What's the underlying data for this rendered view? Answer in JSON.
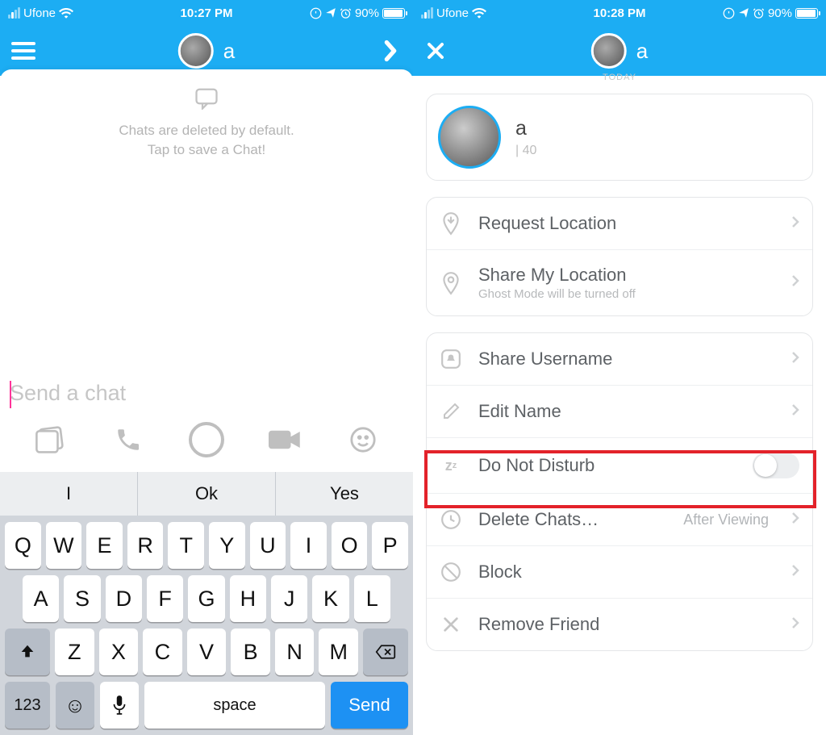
{
  "status": {
    "carrier": "Ufone",
    "time_left": "10:27 PM",
    "time_right": "10:28 PM",
    "battery_pct": "90%"
  },
  "header": {
    "title_left": "a",
    "title_right": "a"
  },
  "chat": {
    "hint_line1": "Chats are deleted by default.",
    "hint_line2": "Tap to save a Chat!",
    "input_placeholder": "Send a chat"
  },
  "keyboard": {
    "suggestions": [
      "I",
      "Ok",
      "Yes"
    ],
    "row1": [
      "Q",
      "W",
      "E",
      "R",
      "T",
      "Y",
      "U",
      "I",
      "O",
      "P"
    ],
    "row2": [
      "A",
      "S",
      "D",
      "F",
      "G",
      "H",
      "J",
      "K",
      "L"
    ],
    "row3": [
      "Z",
      "X",
      "C",
      "V",
      "B",
      "N",
      "M"
    ],
    "num_key": "123",
    "space_label": "space",
    "send_label": "Send"
  },
  "sheet": {
    "today_label": "TODAY",
    "profile": {
      "name": "a",
      "meta": "| 40"
    },
    "request_location": "Request Location",
    "share_location": "Share My Location",
    "share_location_sub": "Ghost Mode will be turned off",
    "share_username": "Share Username",
    "edit_name": "Edit Name",
    "dnd": "Do Not Disturb",
    "delete_chats": "Delete Chats…",
    "delete_chats_value": "After Viewing",
    "block": "Block",
    "remove_friend": "Remove Friend"
  }
}
